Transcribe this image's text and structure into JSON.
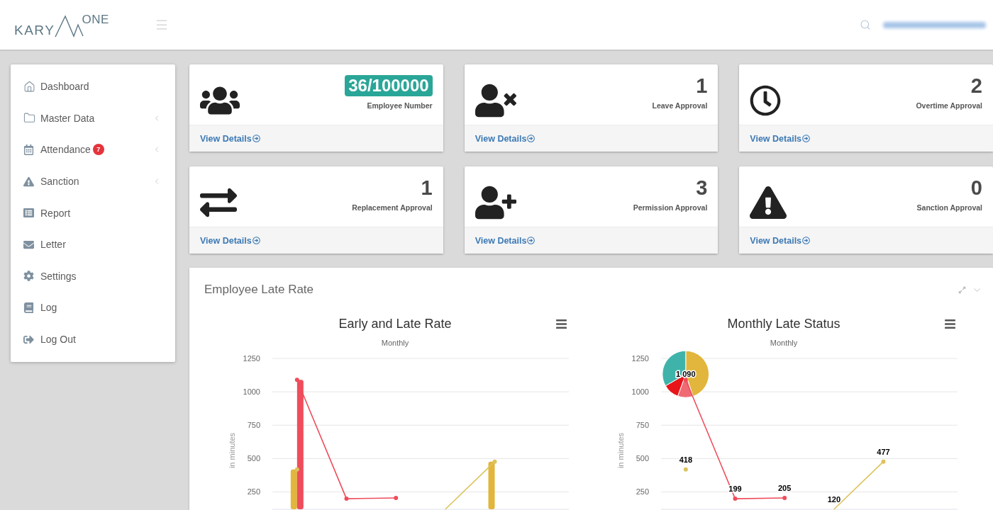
{
  "header": {
    "logo": {
      "text": "KARY",
      "superscript": "ONE"
    }
  },
  "sidebar": {
    "items": [
      {
        "label": "Dashboard",
        "has_submenu": false
      },
      {
        "label": "Master Data",
        "has_submenu": true
      },
      {
        "label": "Attendance",
        "badge": "7",
        "has_submenu": true
      },
      {
        "label": "Sanction",
        "has_submenu": true
      },
      {
        "label": "Report",
        "has_submenu": false
      },
      {
        "label": "Letter",
        "has_submenu": false
      },
      {
        "label": "Settings",
        "has_submenu": false
      },
      {
        "label": "Log",
        "has_submenu": false
      },
      {
        "label": "Log Out",
        "has_submenu": false
      }
    ]
  },
  "cards": [
    {
      "value": "36/100000",
      "label": "Employee Number",
      "highlighted": true,
      "link": "View Details"
    },
    {
      "value": "1",
      "label": "Leave Approval",
      "highlighted": false,
      "link": "View Details"
    },
    {
      "value": "2",
      "label": "Overtime Approval",
      "highlighted": false,
      "link": "View Details"
    },
    {
      "value": "1",
      "label": "Replacement Approval",
      "highlighted": false,
      "link": "View Details"
    },
    {
      "value": "3",
      "label": "Permission Approval",
      "highlighted": false,
      "link": "View Details"
    },
    {
      "value": "0",
      "label": "Sanction Approval",
      "highlighted": false,
      "link": "View Details"
    }
  ],
  "late_rate_panel": {
    "title": "Employee Late Rate",
    "charts": [
      {
        "subtitle": "Monthly",
        "chart_data": {
          "type": "line",
          "title": "Early and Late Rate",
          "ylabel": "in minutes",
          "ylim": [
            120,
            1250
          ],
          "yticks": [
            250,
            500,
            750,
            1000,
            1250
          ],
          "grid": true,
          "stacked": false,
          "series": [
            {
              "type": "bar",
              "color": "#e2b53c",
              "values": [
                418,
                null,
                null,
                null,
                477,
                null
              ]
            },
            {
              "type": "bar",
              "color": "#ee4d5c",
              "values": [
                1090,
                null,
                null,
                null,
                null,
                null
              ]
            },
            {
              "color": "#ee4d5c",
              "marker": true,
              "values": [
                1090,
                199,
                205,
                null,
                null,
                null
              ]
            },
            {
              "color": "#dcc35c",
              "marker": true,
              "values": [
                418,
                null,
                null,
                120,
                477,
                null
              ]
            }
          ]
        }
      },
      {
        "subtitle": "Monthly",
        "pie_marker": true,
        "chart_data": {
          "type": "line",
          "title": "Monthly Late Status",
          "ylabel": "in minutes",
          "ylim": [
            120,
            1250
          ],
          "yticks": [
            250,
            500,
            750,
            1000,
            1250
          ],
          "grid": true,
          "series": [
            {
              "color": "#ee4d5c",
              "marker": true,
              "values": [
                1090,
                199,
                205,
                null,
                null,
                null
              ]
            },
            {
              "color": "#dcc35c",
              "marker": true,
              "values": [
                418,
                null,
                null,
                120,
                477,
                null
              ]
            }
          ],
          "value_labels": [
            [
              "1 090",
              "199",
              "205",
              null,
              null,
              null
            ],
            [
              "418",
              null,
              null,
              "120",
              "477",
              null
            ]
          ]
        }
      }
    ]
  }
}
